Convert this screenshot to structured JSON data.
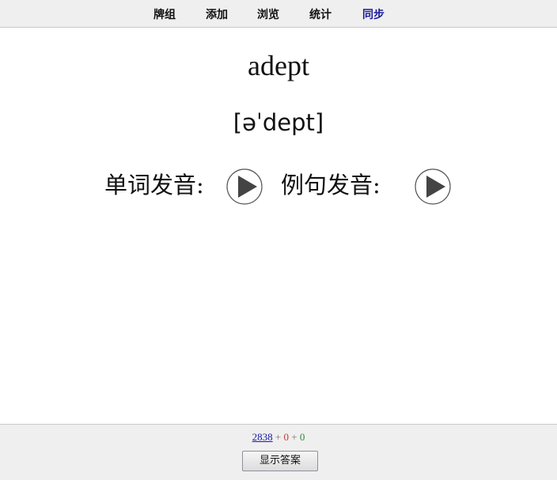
{
  "nav": {
    "items": [
      {
        "label": "牌组"
      },
      {
        "label": "添加"
      },
      {
        "label": "浏览"
      },
      {
        "label": "统计"
      },
      {
        "label": "同步"
      }
    ]
  },
  "card": {
    "word": "adept",
    "phonetic": "[əˈdept]",
    "word_audio_label": "单词发音:",
    "sentence_audio_label": "例句发音:"
  },
  "bottom": {
    "new_count": "2838",
    "separator": "+",
    "learn_count": "0",
    "review_count": "0",
    "show_answer_label": "显示答案"
  },
  "colors": {
    "new_count": "#1a1aa8",
    "learn_count": "#c0392b",
    "review_count": "#2e8b2e",
    "sync_link": "#1a1a9c"
  },
  "icons": [
    "play-icon"
  ]
}
